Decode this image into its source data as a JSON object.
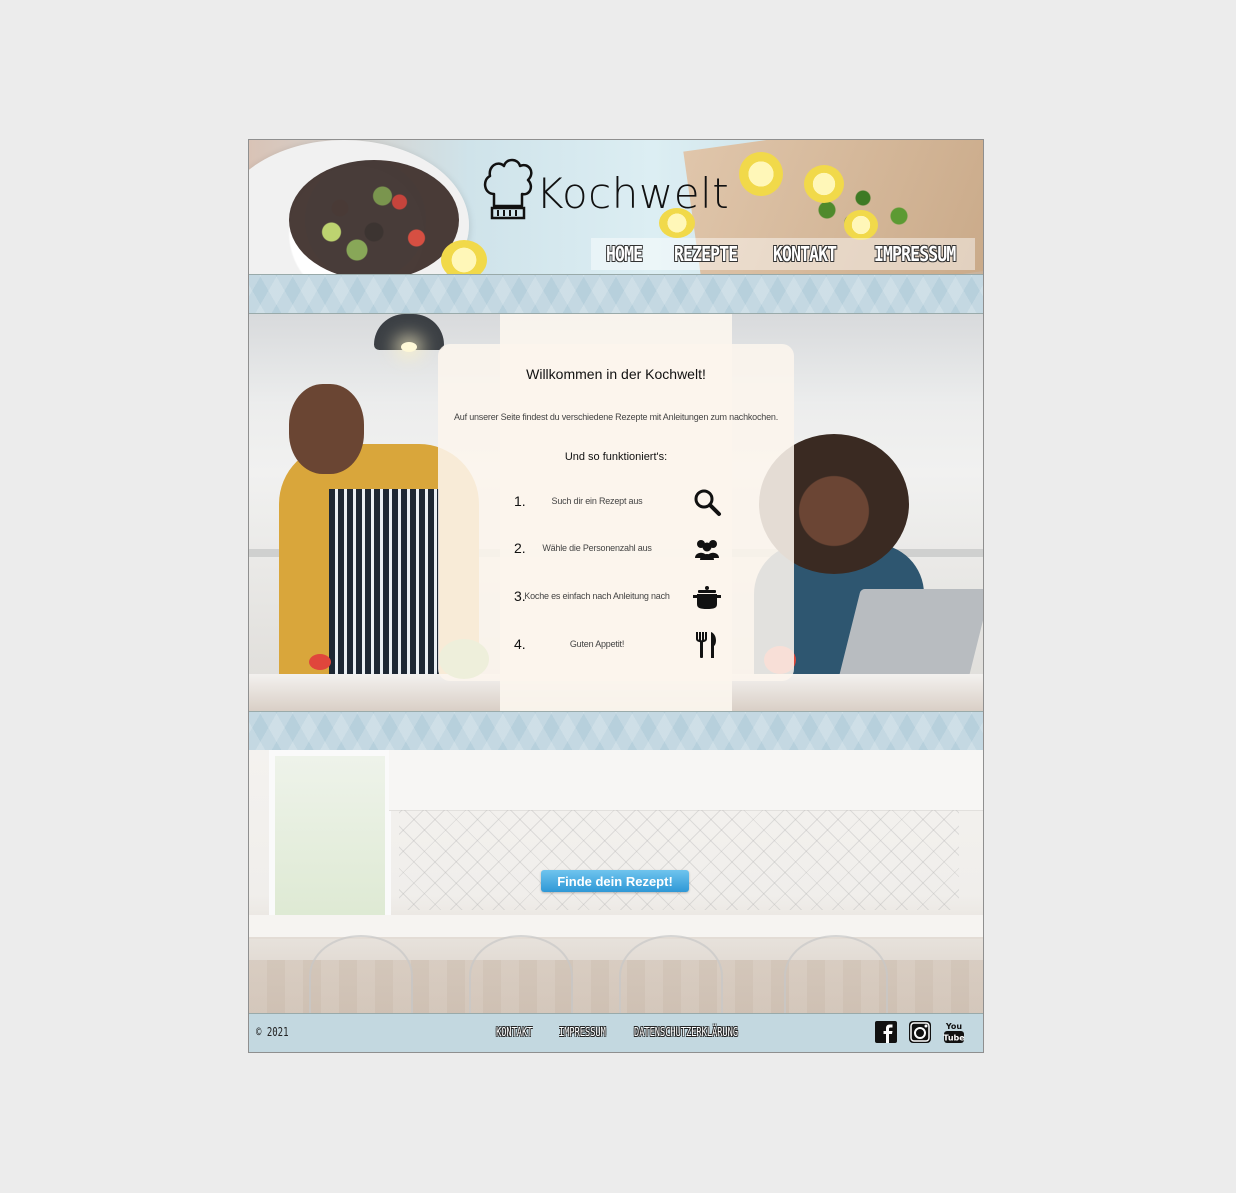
{
  "header": {
    "logo_text": "Kochwelt",
    "nav": [
      "HOME",
      "REZEPTE",
      "KONTAKT",
      "IMPRESSUM"
    ]
  },
  "welcome": {
    "title": "Willkommen in der Kochwelt!",
    "intro": "Auf unserer Seite findest du verschiedene Rezepte mit Anleitungen zum nachkochen.",
    "subtitle": "Und so funktioniert's:",
    "steps": [
      {
        "num": "1.",
        "text": "Such dir ein Rezept aus",
        "icon": "search-icon"
      },
      {
        "num": "2.",
        "text": "Wähle die Personenzahl aus",
        "icon": "people-icon"
      },
      {
        "num": "3.",
        "text": "Koche es einfach nach Anleitung nach",
        "icon": "pot-icon"
      },
      {
        "num": "4.",
        "text": "Guten Appetit!",
        "icon": "cutlery-icon"
      }
    ]
  },
  "cta": {
    "label": "Finde dein Rezept!"
  },
  "footer": {
    "copyright": "© 2021",
    "links": [
      "KONTAKT",
      "IMPRESSUM",
      "DATENSCHUTZERKLÄRUNG"
    ],
    "social": [
      "facebook-icon",
      "instagram-icon",
      "youtube-icon"
    ]
  },
  "colors": {
    "accent": "#2f98d6",
    "stripe": "#b7d0dc",
    "footer": "#c3d8e0",
    "card": "#fcf5ed"
  }
}
